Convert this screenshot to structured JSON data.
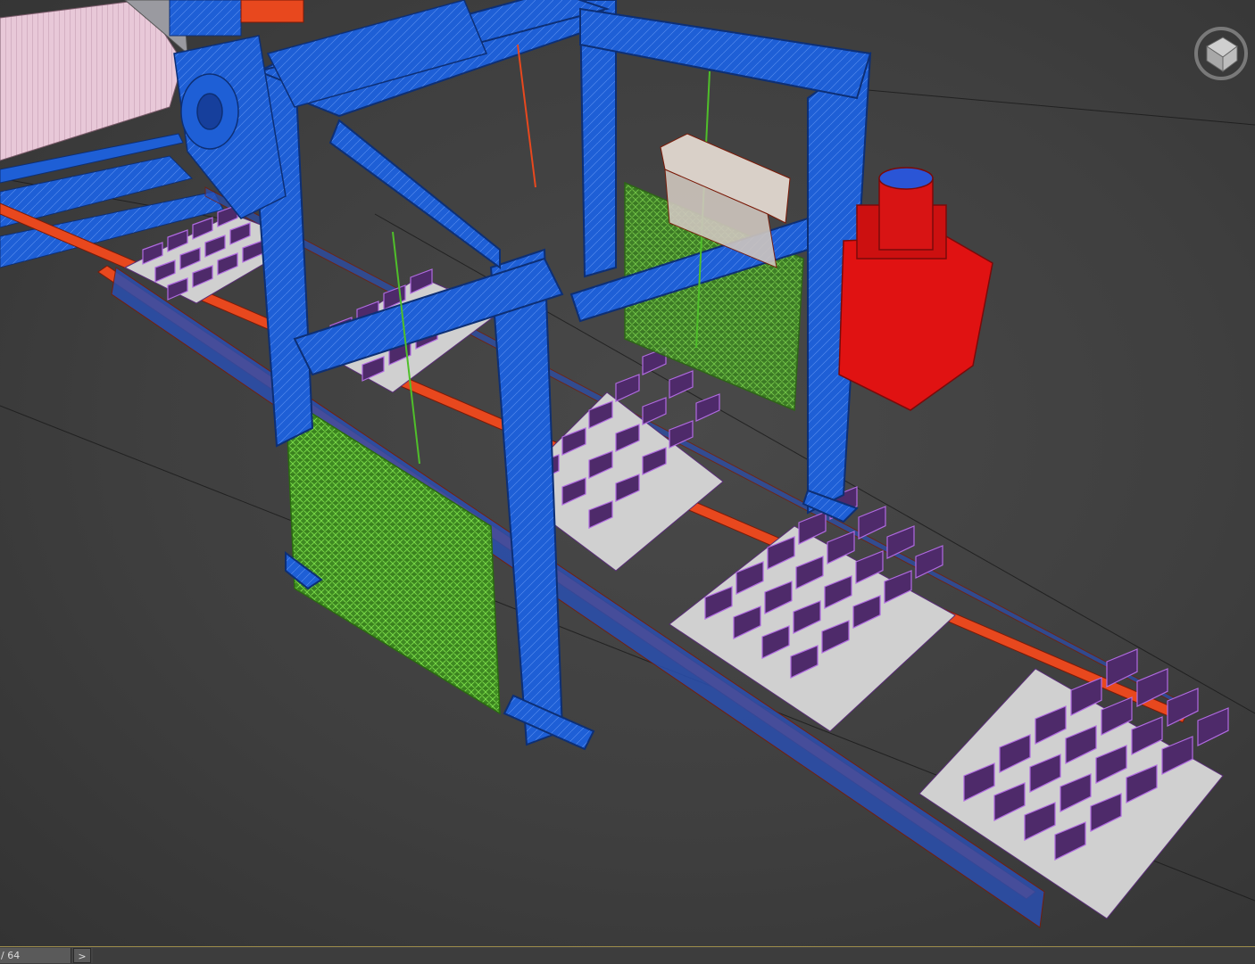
{
  "timeline": {
    "frame_display": "/ 64",
    "next_button_label": ">"
  },
  "colors": {
    "viewport_bg": "#424242",
    "frame_blue": "#1e5fd6",
    "mesh_green": "#4fbf2a",
    "rail_orange": "#e8481e",
    "block_purple": "#5a2e78",
    "motor_red": "#e01212",
    "pallet_grey": "#cfcfcf",
    "timeline_accent": "#9a8a4a"
  },
  "icons": {
    "viewcube": "viewcube-icon",
    "next": "chevron-right-icon"
  }
}
